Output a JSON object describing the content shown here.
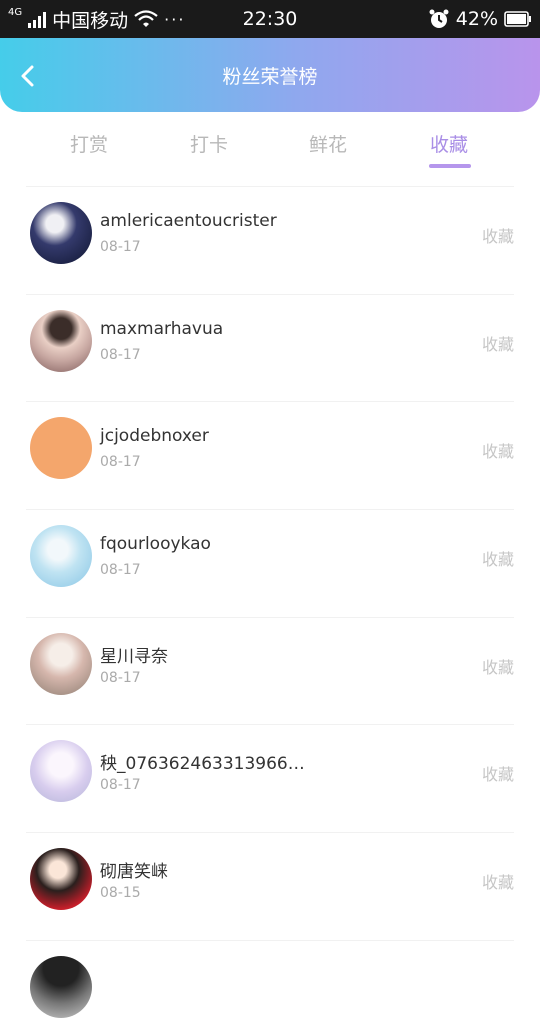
{
  "status_bar": {
    "network": "4G",
    "carrier": "中国移动",
    "more": "···",
    "time": "22:30",
    "battery": "42%"
  },
  "header": {
    "title": "粉丝荣誉榜"
  },
  "tabs": [
    {
      "label": "打赏",
      "active": false
    },
    {
      "label": "打卡",
      "active": false
    },
    {
      "label": "鲜花",
      "active": false
    },
    {
      "label": "收藏",
      "active": true
    }
  ],
  "list": [
    {
      "name": "amlericaentoucrister",
      "date": "08-17",
      "type": "收藏"
    },
    {
      "name": "maxmarhavua",
      "date": "08-17",
      "type": "收藏"
    },
    {
      "name": "jcjodebnoxer",
      "date": "08-17",
      "type": "收藏"
    },
    {
      "name": "fqourlooykao",
      "date": "08-17",
      "type": "收藏"
    },
    {
      "name": "星川寻奈",
      "date": "08-17",
      "type": "收藏"
    },
    {
      "name": "秧_076362463313966…",
      "date": "08-17",
      "type": "收藏"
    },
    {
      "name": "砌唐笑崃",
      "date": "08-15",
      "type": "收藏"
    }
  ],
  "colors": {
    "header_gradient_start": "#45cdea",
    "header_gradient_end": "#b994ec",
    "active_tab": "#a98ee6",
    "inactive_tab": "#b8b8b8",
    "type_text": "#c6c6c6"
  }
}
